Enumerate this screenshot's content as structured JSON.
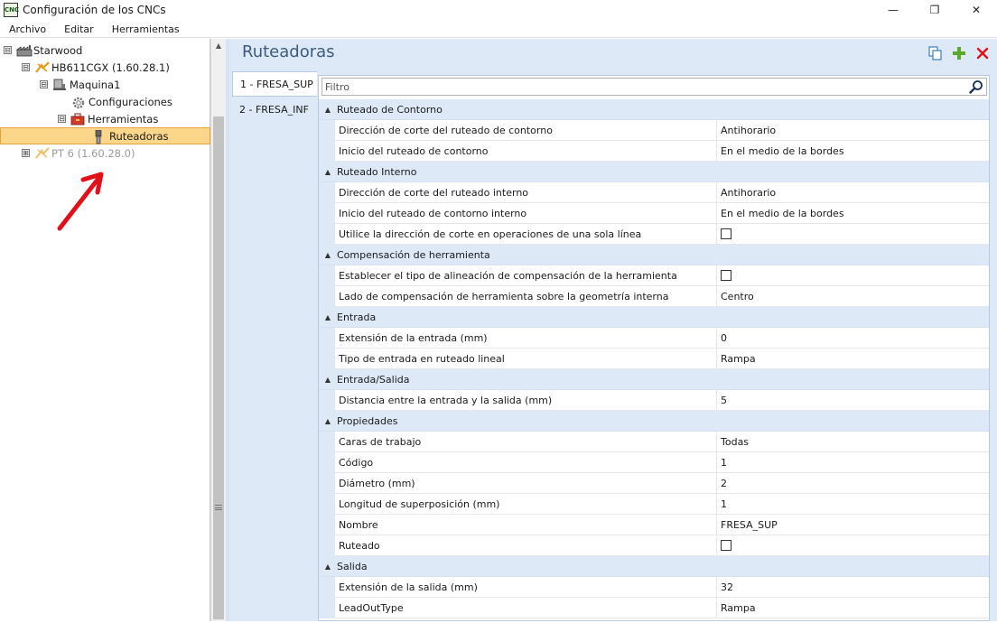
{
  "window": {
    "title": "Configuración de los CNCs",
    "app_icon_text": "CNC",
    "minimize_glyph": "—",
    "restore_glyph": "❐",
    "close_glyph": "✕"
  },
  "menu": {
    "items": [
      "Archivo",
      "Editar",
      "Herramientas"
    ]
  },
  "tree": {
    "nodes": [
      {
        "label": "Starwood",
        "toggle": "⊟"
      },
      {
        "label": "HB611CGX (1.60.28.1)",
        "toggle": "⊟"
      },
      {
        "label": "Maquina1",
        "toggle": "⊟"
      },
      {
        "label": "Configuraciones",
        "toggle": ""
      },
      {
        "label": "Herramientas",
        "toggle": "⊟"
      },
      {
        "label": "Ruteadoras",
        "toggle": "",
        "selected": true
      },
      {
        "label": "PT 6 (1.60.28.0)",
        "toggle": "⊞",
        "dim": true
      }
    ]
  },
  "header": {
    "title": "Ruteadoras"
  },
  "tabs": [
    "1 - FRESA_SUP",
    "2 - FRESA_INF"
  ],
  "filter": {
    "placeholder": "Filtro"
  },
  "categories": [
    {
      "label": "Ruteado de Contorno",
      "props": [
        {
          "name": "Dirección de corte del ruteado de contorno",
          "value": "Antihorario"
        },
        {
          "name": "Inicio del ruteado de contorno",
          "value": "En el medio de la bordes"
        }
      ]
    },
    {
      "label": "Ruteado Interno",
      "props": [
        {
          "name": "Dirección de corte del ruteado interno",
          "value": "Antihorario"
        },
        {
          "name": "Inicio del ruteado de contorno interno",
          "value": "En el medio de la bordes"
        },
        {
          "name": "Utilice la dirección de corte en operaciones de una sola línea",
          "value": "",
          "checkbox": true
        }
      ]
    },
    {
      "label": "Compensación de herramienta",
      "props": [
        {
          "name": "Establecer el tipo de alineación de compensación de la herramienta",
          "value": "",
          "checkbox": true
        },
        {
          "name": "Lado de compensación de herramienta sobre la geometría interna",
          "value": "Centro"
        }
      ]
    },
    {
      "label": "Entrada",
      "props": [
        {
          "name": "Extensión de la entrada (mm)",
          "value": "0"
        },
        {
          "name": "Tipo de entrada en ruteado lineal",
          "value": "Rampa"
        }
      ]
    },
    {
      "label": "Entrada/Salida",
      "props": [
        {
          "name": "Distancia entre la entrada y la salida (mm)",
          "value": "5"
        }
      ]
    },
    {
      "label": "Propiedades",
      "props": [
        {
          "name": "Caras de trabajo",
          "value": "Todas"
        },
        {
          "name": "Código",
          "value": "1"
        },
        {
          "name": "Diámetro (mm)",
          "value": "2"
        },
        {
          "name": "Longitud de superposición (mm)",
          "value": "1"
        },
        {
          "name": "Nombre",
          "value": "FRESA_SUP"
        },
        {
          "name": "Ruteado",
          "value": "",
          "checkbox": true
        }
      ]
    },
    {
      "label": "Salida",
      "props": [
        {
          "name": "Extensión de la salida (mm)",
          "value": "32"
        },
        {
          "name": "LeadOutType",
          "value": "Rampa"
        }
      ]
    }
  ],
  "colors": {
    "accent_panel": "#dde9f7",
    "selection": "#fcd68a",
    "title_blue": "#3c5a80",
    "annotation_red": "#e3101a"
  }
}
